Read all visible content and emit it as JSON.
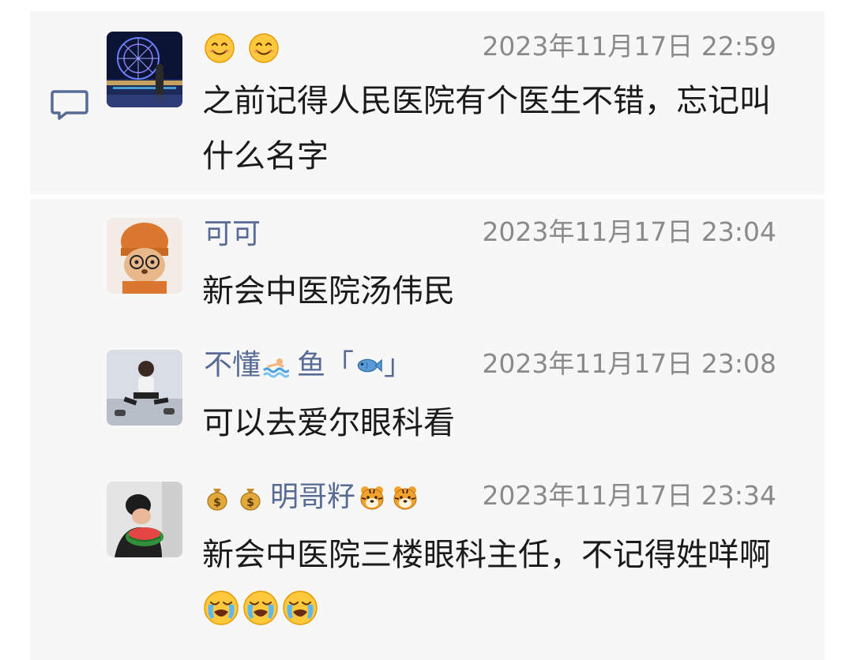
{
  "post": {
    "author_emojis": [
      "smiling-face-emoji",
      "smiling-face-emoji"
    ],
    "timestamp": "2023年11月17日 22:59",
    "text": "之前记得人民医院有个医生不错，忘记叫什么名字",
    "comment_icon": "comment-bubble-icon"
  },
  "replies": [
    {
      "name": "可可",
      "timestamp": "2023年11月17日 23:04",
      "text": "新会中医院汤伟民"
    },
    {
      "name_part1": "不懂",
      "name_part2": "鱼「",
      "name_part3": "」",
      "name_emojis": [
        "swimmer-emoji",
        "fish-emoji"
      ],
      "timestamp": "2023年11月17日 23:08",
      "text": "可以去爱尔眼科看"
    },
    {
      "name": "明哥籽",
      "name_emojis": [
        "money-bag-emoji",
        "money-bag-emoji",
        "tiger-face-emoji",
        "tiger-face-emoji"
      ],
      "timestamp": "2023年11月17日 23:34",
      "text": "新会中医院三楼眼科主任，不记得姓咩啊",
      "trailing_emojis": [
        "crying-emoji",
        "crying-emoji",
        "crying-emoji"
      ]
    }
  ]
}
